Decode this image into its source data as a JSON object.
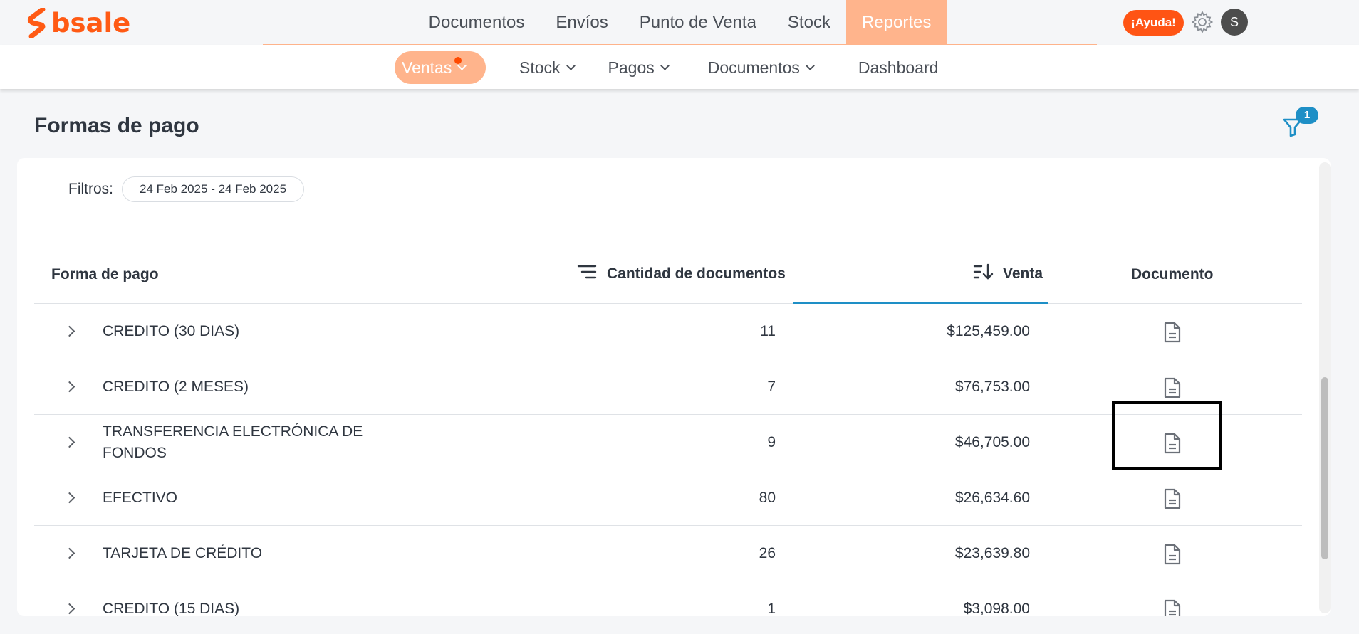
{
  "brand": {
    "name": "bsale",
    "color": "#ff5a14"
  },
  "main_nav": [
    {
      "label": "Documentos"
    },
    {
      "label": "Envíos"
    },
    {
      "label": "Punto de Venta"
    },
    {
      "label": "Stock"
    },
    {
      "label": "Reportes",
      "active": true
    }
  ],
  "header": {
    "help_label": "¡Ayuda!",
    "avatar_initial": "S",
    "settings_icon": "gear-icon"
  },
  "sub_nav": [
    {
      "label": "Ventas",
      "active": true,
      "has_dropdown": true,
      "notification_dot": true
    },
    {
      "label": "Stock",
      "has_dropdown": true
    },
    {
      "label": "Pagos",
      "has_dropdown": true
    },
    {
      "label": "Documentos",
      "has_dropdown": true
    },
    {
      "label": "Dashboard",
      "has_dropdown": false
    }
  ],
  "page": {
    "title": "Formas de pago",
    "filter_badge_count": "1"
  },
  "filters": {
    "label": "Filtros:",
    "date_range": "24 Feb 2025 - 24 Feb 2025"
  },
  "table": {
    "columns": {
      "payment_method": "Forma de pago",
      "doc_count": "Cantidad de documentos",
      "sales": "Venta",
      "document": "Documento"
    },
    "sorted_column": "Venta",
    "rows": [
      {
        "name": "CREDITO (30 DIAS)",
        "count": "11",
        "amount": "$125,459.00"
      },
      {
        "name": "CREDITO (2 MESES)",
        "count": "7",
        "amount": "$76,753.00"
      },
      {
        "name": "TRANSFERENCIA ELECTRÓNICA DE FONDOS",
        "count": "9",
        "amount": "$46,705.00"
      },
      {
        "name": "EFECTIVO",
        "count": "80",
        "amount": "$26,634.60"
      },
      {
        "name": "TARJETA DE CRÉDITO",
        "count": "26",
        "amount": "$23,639.80"
      },
      {
        "name": "CREDITO (15 DIAS)",
        "count": "1",
        "amount": "$3,098.00"
      }
    ]
  },
  "colors": {
    "accent": "#ffb48c",
    "help": "#ff5414",
    "sort_active": "#1e8fc6"
  }
}
